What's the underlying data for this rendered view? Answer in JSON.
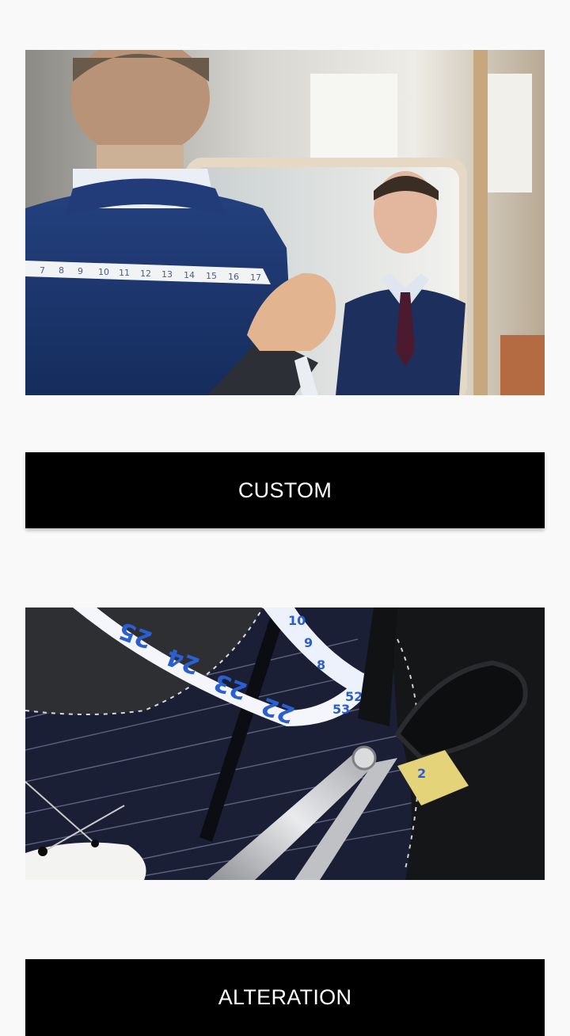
{
  "services": [
    {
      "label": "CUSTOM",
      "image_icon": "tailor-measuring-photo"
    },
    {
      "label": "ALTERATION",
      "image_icon": "scissors-tape-photo"
    }
  ],
  "colors": {
    "background": "#f9f9f9",
    "button_bg": "#000000",
    "button_text": "#ffffff",
    "suit_navy": "#1f3a78",
    "tape_blue": "#2b5fd0"
  }
}
